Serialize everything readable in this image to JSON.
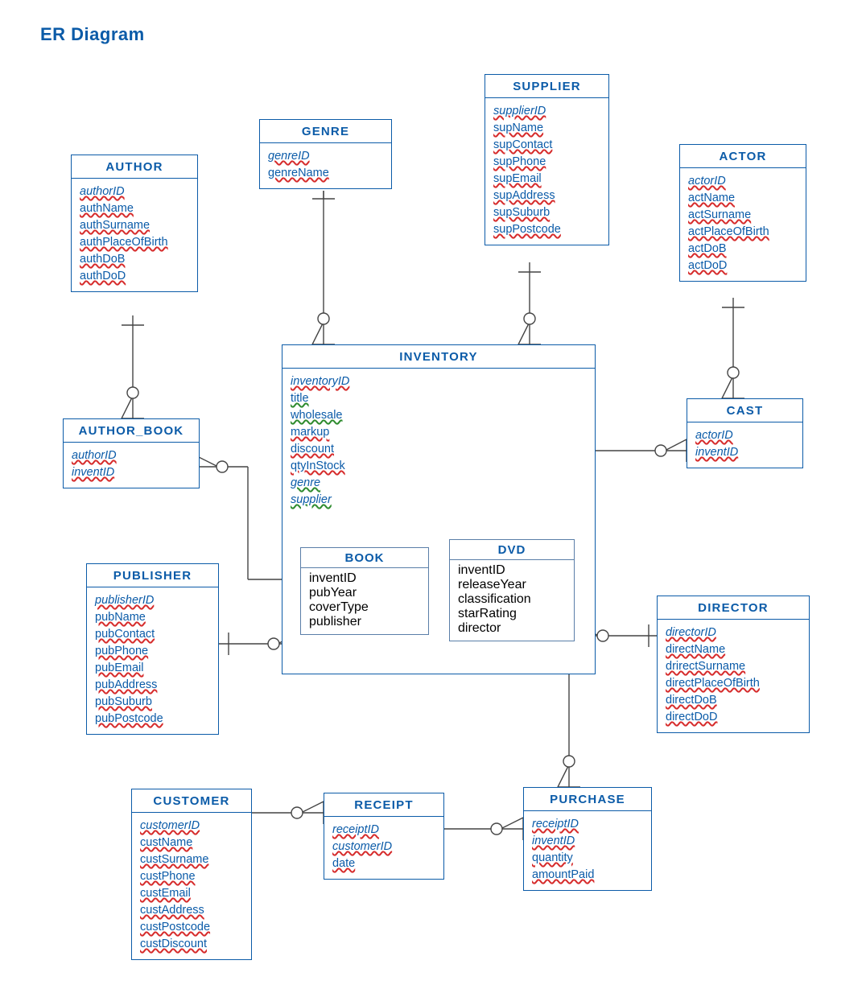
{
  "title": "ER Diagram",
  "entities": {
    "author": {
      "name": "AUTHOR",
      "attrs": [
        [
          "authorID",
          "both-pk"
        ],
        [
          "authName",
          "red"
        ],
        [
          "authSurname",
          "red"
        ],
        [
          "authPlaceOfBirth",
          "red"
        ],
        [
          "authDoB",
          "red"
        ],
        [
          "authDoD",
          "red"
        ]
      ]
    },
    "genre": {
      "name": "GENRE",
      "attrs": [
        [
          "genreID",
          "both-pk"
        ],
        [
          "genreName",
          "red"
        ]
      ]
    },
    "supplier": {
      "name": "SUPPLIER",
      "attrs": [
        [
          "supplierID",
          "both-pk"
        ],
        [
          "supName",
          "red"
        ],
        [
          "supContact",
          "red"
        ],
        [
          "supPhone",
          "red"
        ],
        [
          "supEmail",
          "red"
        ],
        [
          "supAddress",
          "red"
        ],
        [
          "supSuburb",
          "red"
        ],
        [
          "supPostcode",
          "red"
        ]
      ]
    },
    "actor": {
      "name": "ACTOR",
      "attrs": [
        [
          "actorID",
          "both-pk"
        ],
        [
          "actName",
          "red"
        ],
        [
          "actSurname",
          "red"
        ],
        [
          "actPlaceOfBirth",
          "red"
        ],
        [
          "actDoB",
          "red"
        ],
        [
          "actDoD",
          "red"
        ]
      ]
    },
    "authorbook": {
      "name": "AUTHOR_BOOK",
      "attrs": [
        [
          "authorID",
          "both-ital"
        ],
        [
          "inventID",
          "both-ital"
        ]
      ]
    },
    "inventory": {
      "name": "INVENTORY",
      "attrs": [
        [
          "inventoryID",
          "both-ital"
        ],
        [
          "title",
          "green"
        ],
        [
          "wholesale",
          "green"
        ],
        [
          "markup",
          "red"
        ],
        [
          "discount",
          "red"
        ],
        [
          "qtyInStock",
          "red"
        ],
        [
          "genre",
          "green-ital"
        ],
        [
          "supplier",
          "green-ital"
        ]
      ]
    },
    "cast": {
      "name": "CAST",
      "attrs": [
        [
          "actorID",
          "both-ital"
        ],
        [
          "inventID",
          "both-ital"
        ]
      ]
    },
    "publisher": {
      "name": "PUBLISHER",
      "attrs": [
        [
          "publisherID",
          "both-pk"
        ],
        [
          "pubName",
          "red"
        ],
        [
          "pubContact",
          "red"
        ],
        [
          "pubPhone",
          "red"
        ],
        [
          "pubEmail",
          "red"
        ],
        [
          "pubAddress",
          "red"
        ],
        [
          "pubSuburb",
          "red"
        ],
        [
          "pubPostcode",
          "red"
        ]
      ]
    },
    "book": {
      "name": "BOOK",
      "attrs": [
        [
          "inventID",
          "both-ital"
        ],
        [
          "pubYear",
          "red"
        ],
        [
          "coverType",
          "red"
        ],
        [
          "publisher",
          "green-ital"
        ]
      ]
    },
    "dvd": {
      "name": "DVD",
      "attrs": [
        [
          "inventID",
          "both-ital"
        ],
        [
          "releaseYear",
          "red"
        ],
        [
          "classification",
          "green"
        ],
        [
          "starRating",
          "red"
        ],
        [
          "director",
          "green-ital"
        ]
      ]
    },
    "director": {
      "name": "DIRECTOR",
      "attrs": [
        [
          "directorID",
          "both-pk"
        ],
        [
          "directName",
          "red"
        ],
        [
          "drirectSurname",
          "red"
        ],
        [
          "directPlaceOfBirth",
          "red"
        ],
        [
          "directDoB",
          "red"
        ],
        [
          "directDoD",
          "red"
        ]
      ]
    },
    "customer": {
      "name": "CUSTOMER",
      "attrs": [
        [
          "customerID",
          "both-pk"
        ],
        [
          "custName",
          "red"
        ],
        [
          "custSurname",
          "red"
        ],
        [
          "custPhone",
          "red"
        ],
        [
          "custEmail",
          "red"
        ],
        [
          "custAddress",
          "red"
        ],
        [
          "custPostcode",
          "red"
        ],
        [
          "custDiscount",
          "red"
        ]
      ]
    },
    "receipt": {
      "name": "RECEIPT",
      "attrs": [
        [
          "receiptID",
          "both-pk"
        ],
        [
          "customerID",
          "both-ital"
        ],
        [
          "date",
          "red"
        ]
      ]
    },
    "purchase": {
      "name": "PURCHASE",
      "attrs": [
        [
          "receiptID",
          "both-ital"
        ],
        [
          "inventID",
          "both-ital"
        ],
        [
          "quantity",
          "red"
        ],
        [
          "amountPaid",
          "red"
        ]
      ]
    }
  },
  "chart_data": {
    "type": "erd",
    "entities": [
      {
        "name": "AUTHOR",
        "pk": [
          "authorID"
        ],
        "attrs": [
          "authName",
          "authSurname",
          "authPlaceOfBirth",
          "authDoB",
          "authDoD"
        ]
      },
      {
        "name": "GENRE",
        "pk": [
          "genreID"
        ],
        "attrs": [
          "genreName"
        ]
      },
      {
        "name": "SUPPLIER",
        "pk": [
          "supplierID"
        ],
        "attrs": [
          "supName",
          "supContact",
          "supPhone",
          "supEmail",
          "supAddress",
          "supSuburb",
          "supPostcode"
        ]
      },
      {
        "name": "ACTOR",
        "pk": [
          "actorID"
        ],
        "attrs": [
          "actName",
          "actSurname",
          "actPlaceOfBirth",
          "actDoB",
          "actDoD"
        ]
      },
      {
        "name": "AUTHOR_BOOK",
        "pk": [
          "authorID",
          "inventID"
        ],
        "attrs": []
      },
      {
        "name": "INVENTORY",
        "pk": [
          "inventoryID"
        ],
        "attrs": [
          "title",
          "wholesale",
          "markup",
          "discount",
          "qtyInStock"
        ],
        "fk": [
          "genre",
          "supplier"
        ]
      },
      {
        "name": "CAST",
        "pk": [
          "actorID",
          "inventID"
        ],
        "attrs": []
      },
      {
        "name": "PUBLISHER",
        "pk": [
          "publisherID"
        ],
        "attrs": [
          "pubName",
          "pubContact",
          "pubPhone",
          "pubEmail",
          "pubAddress",
          "pubSuburb",
          "pubPostcode"
        ]
      },
      {
        "name": "BOOK",
        "pk": [
          "inventID"
        ],
        "attrs": [
          "pubYear",
          "coverType"
        ],
        "fk": [
          "publisher"
        ]
      },
      {
        "name": "DVD",
        "pk": [
          "inventID"
        ],
        "attrs": [
          "releaseYear",
          "classification",
          "starRating"
        ],
        "fk": [
          "director"
        ]
      },
      {
        "name": "DIRECTOR",
        "pk": [
          "directorID"
        ],
        "attrs": [
          "directName",
          "drirectSurname",
          "directPlaceOfBirth",
          "directDoB",
          "directDoD"
        ]
      },
      {
        "name": "CUSTOMER",
        "pk": [
          "customerID"
        ],
        "attrs": [
          "custName",
          "custSurname",
          "custPhone",
          "custEmail",
          "custAddress",
          "custPostcode",
          "custDiscount"
        ]
      },
      {
        "name": "RECEIPT",
        "pk": [
          "receiptID"
        ],
        "attrs": [
          "date"
        ],
        "fk": [
          "customerID"
        ]
      },
      {
        "name": "PURCHASE",
        "pk": [
          "receiptID",
          "inventID"
        ],
        "attrs": [
          "quantity",
          "amountPaid"
        ]
      }
    ],
    "relationships": [
      {
        "from": "AUTHOR",
        "to": "AUTHOR_BOOK",
        "card": "1..*"
      },
      {
        "from": "AUTHOR_BOOK",
        "to": "BOOK",
        "card": "0..*-1"
      },
      {
        "from": "GENRE",
        "to": "INVENTORY",
        "card": "1-0..*"
      },
      {
        "from": "SUPPLIER",
        "to": "INVENTORY",
        "card": "1-0..*"
      },
      {
        "from": "ACTOR",
        "to": "CAST",
        "card": "1-0..*"
      },
      {
        "from": "CAST",
        "to": "DVD",
        "card": "0..*-1"
      },
      {
        "from": "PUBLISHER",
        "to": "BOOK",
        "card": "1-0..*"
      },
      {
        "from": "DVD",
        "to": "DIRECTOR",
        "card": "0..*-1"
      },
      {
        "from": "INVENTORY",
        "to": "PURCHASE",
        "card": "1-0..*"
      },
      {
        "from": "CUSTOMER",
        "to": "RECEIPT",
        "card": "1-0..*"
      },
      {
        "from": "RECEIPT",
        "to": "PURCHASE",
        "card": "1-0..*"
      }
    ]
  }
}
